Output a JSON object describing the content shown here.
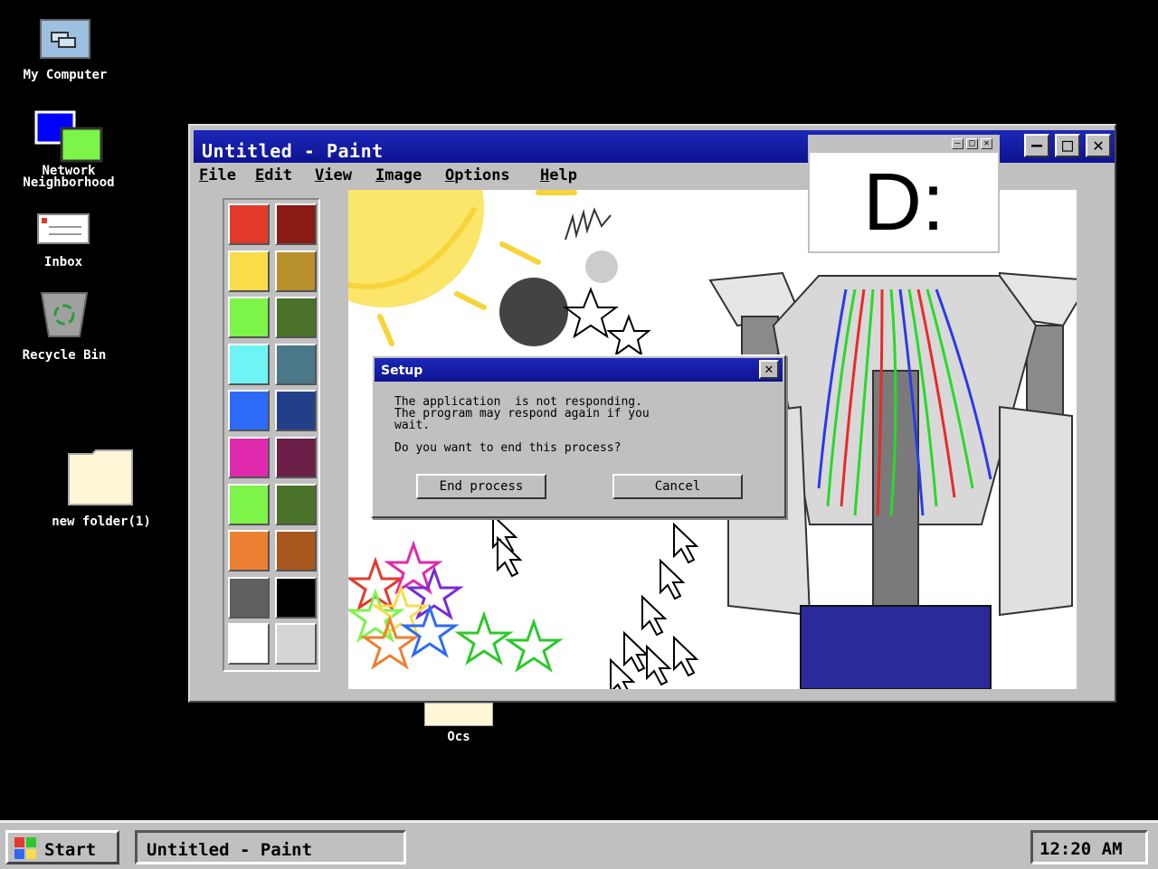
{
  "desktop": {
    "icons": [
      {
        "label": "My Computer"
      },
      {
        "label": "Network\nNeighborhood"
      },
      {
        "label": "Inbox"
      },
      {
        "label": "Recycle Bin"
      },
      {
        "label": "new folder(1)"
      },
      {
        "label": "Ocs"
      }
    ]
  },
  "paint": {
    "title": "Untitled - Paint",
    "menu": [
      "File",
      "Edit",
      "View",
      "Image",
      "Options",
      "Help"
    ],
    "palette": [
      "#e33a2c",
      "#8a1a14",
      "#f8dc4a",
      "#b8902c",
      "#7cf448",
      "#4a7228",
      "#6ef4f4",
      "#4a7888",
      "#2e6af8",
      "#22408a",
      "#e02aae",
      "#6a1e48",
      "#7cf448",
      "#4a7228",
      "#ec8032",
      "#a8581e",
      "#606060",
      "#000000",
      "#ffffff",
      "#d6d6d6"
    ]
  },
  "d_window": {
    "text": "D:"
  },
  "setup_dialog": {
    "title": "Setup",
    "message": "The application  is not responding.\nThe program may respond again if you\nwait.",
    "question": "Do you want to end this process?",
    "end_label": "End process",
    "cancel_label": "Cancel"
  },
  "taskbar": {
    "start_label": "Start",
    "task_label": "Untitled - Paint",
    "clock": "12:20 AM"
  }
}
